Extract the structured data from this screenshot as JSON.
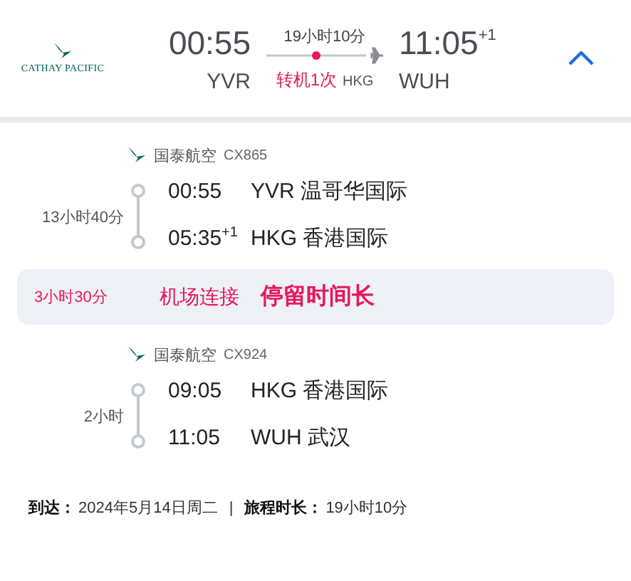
{
  "summary": {
    "airline_logo": "CATHAY PACIFIC",
    "departure_time": "00:55",
    "departure_code": "YVR",
    "duration": "19小时10分",
    "stops": "转机1次",
    "stop_code": "HKG",
    "arrival_time": "11:05",
    "arrival_day_offset": "+1",
    "arrival_code": "WUH",
    "expanded": true
  },
  "itinerary": [
    {
      "kind": "flight",
      "airline": "国泰航空",
      "flight_no": "CX865",
      "duration": "13小时40分",
      "stops": [
        {
          "time": "00:55",
          "airport": "YVR 温哥华国际"
        },
        {
          "time": "05:35",
          "day_offset": "+1",
          "airport": "HKG 香港国际"
        }
      ]
    },
    {
      "kind": "transfer",
      "duration": "3小时30分",
      "type": "机场连接",
      "note": "停留时间长"
    },
    {
      "kind": "flight",
      "airline": "国泰航空",
      "flight_no": "CX924",
      "duration": "2小时",
      "stops": [
        {
          "time": "09:05",
          "airport": "HKG 香港国际"
        },
        {
          "time": "11:05",
          "airport": "WUH 武汉"
        }
      ]
    }
  ],
  "footer": {
    "arrival_label": "到达：",
    "arrival_date": "2024年5月14日周二",
    "separator": "|",
    "total_label": "旅程时长：",
    "total_duration": "19小时10分"
  }
}
